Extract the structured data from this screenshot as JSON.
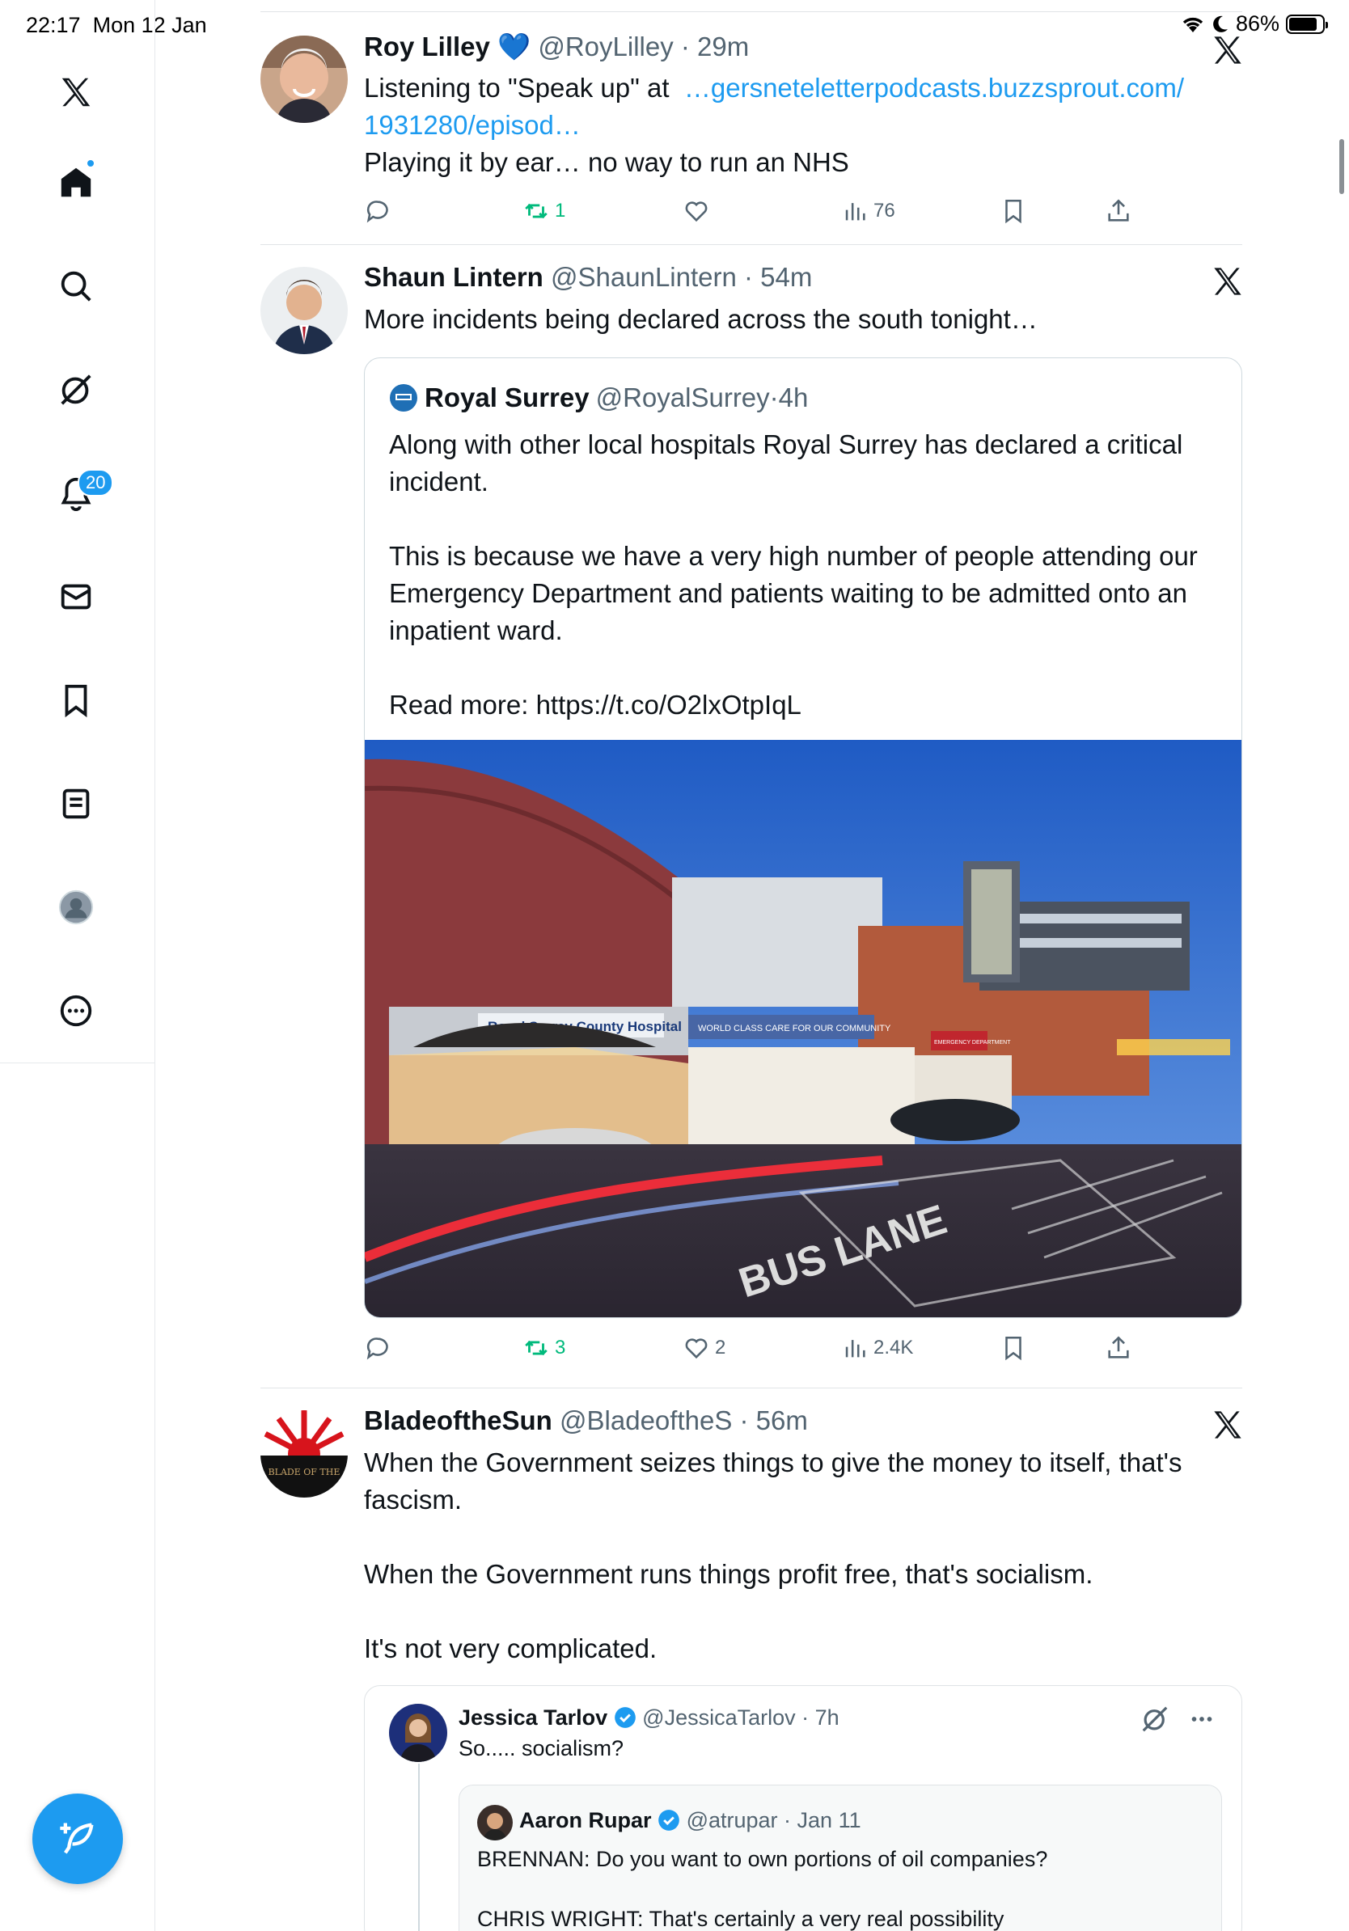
{
  "status_bar": {
    "time": "22:17",
    "date": "Mon 12 Jan",
    "battery": "86%",
    "battery_level": 0.86
  },
  "sidebar": {
    "notifications_badge": "20",
    "items": [
      "home-icon",
      "search-icon",
      "grok-icon",
      "notifications-icon",
      "messages-icon",
      "bookmarks-icon",
      "lists-icon",
      "profile-icon",
      "more-icon"
    ]
  },
  "tweets": [
    {
      "name": "Roy Lilley",
      "emoji": "💙",
      "handle": "@RoyLilley",
      "time": "29m",
      "text_prefix": "Listening to \"Speak up\" at",
      "link_line1": "…gersneteletterpodcasts.buzzsprout.com/",
      "link_line2": "1931280/episod…",
      "text_suffix": "Playing it by ear… no way to run an NHS",
      "retweets": "1",
      "views": "76"
    },
    {
      "name": "Shaun Lintern",
      "handle": "@ShaunLintern",
      "time": "54m",
      "text": "More incidents being declared across the south tonight…",
      "retweets": "3",
      "likes": "2",
      "views": "2.4K",
      "quote": {
        "name": "Royal Surrey",
        "handle": "@RoyalSurrey",
        "time": "4h",
        "p1": "Along with other local hospitals Royal Surrey has declared a critical incident.",
        "p2": "This is because we have a very high number of people attending our Emergency Department and patients waiting to be admitted onto an inpatient ward.",
        "p3": "Read more: https://t.co/O2lxOtpIqL",
        "photo_sign": "Royal Surrey County Hospital",
        "photo_banner": "WORLD CLASS CARE FOR OUR COMMUNITY",
        "photo_ed_sign": "EMERGENCY DEPARTMENT",
        "road_text": "BUS LANE"
      }
    },
    {
      "name": "BladeoftheSun",
      "handle": "@BladeoftheS",
      "time": "56m",
      "p1": "When the Government seizes things to give the money to itself, that's fascism.",
      "p2": "When the Government runs things profit free, that's socialism.",
      "p3": "It's not very complicated.",
      "avatar_text": "BLADE OF THE",
      "embed": {
        "name": "Jessica Tarlov",
        "handle": "@JessicaTarlov",
        "time": "7h",
        "text": "So..... socialism?",
        "inner": {
          "name": "Aaron Rupar",
          "handle": "@atrupar",
          "time": "Jan 11",
          "line1": "BRENNAN: Do you want to own portions of oil companies?",
          "line2": "CHRIS WRIGHT: That's certainly a very real possibility"
        }
      }
    }
  ]
}
